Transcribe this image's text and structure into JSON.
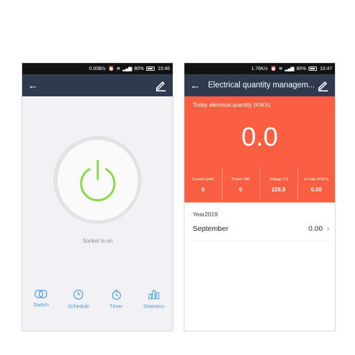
{
  "left": {
    "statusbar": {
      "speed": "0.00B/s",
      "battery": "80%",
      "time": "10:46"
    },
    "status_text": "Socket is on",
    "nav": [
      {
        "label": "Switch",
        "icon": "switch-icon"
      },
      {
        "label": "Schedule",
        "icon": "clock-icon"
      },
      {
        "label": "Timer",
        "icon": "timer-icon"
      },
      {
        "label": "Statistics",
        "icon": "bar-chart-icon"
      }
    ],
    "colors": {
      "power_green": "#8bd94a",
      "nav_blue": "#4a9ee0"
    }
  },
  "right": {
    "statusbar": {
      "speed": "1.76K/s",
      "battery": "80%",
      "time": "10:47"
    },
    "title": "Electrical quantity managem...",
    "today_label": "Today electrical quantity (KW.h)",
    "today_value": "0.0",
    "metrics": [
      {
        "label": "Current (mA)",
        "value": "0"
      },
      {
        "label": "Power (W)",
        "value": "0"
      },
      {
        "label": "Voltage (V)",
        "value": "226.9"
      },
      {
        "label": "In total (KW.h)",
        "value": "0.00"
      }
    ],
    "year": "Year2019",
    "month": {
      "name": "September",
      "value": "0.00"
    },
    "colors": {
      "header": "#2f3a4e",
      "accent": "#fb5f41"
    }
  }
}
